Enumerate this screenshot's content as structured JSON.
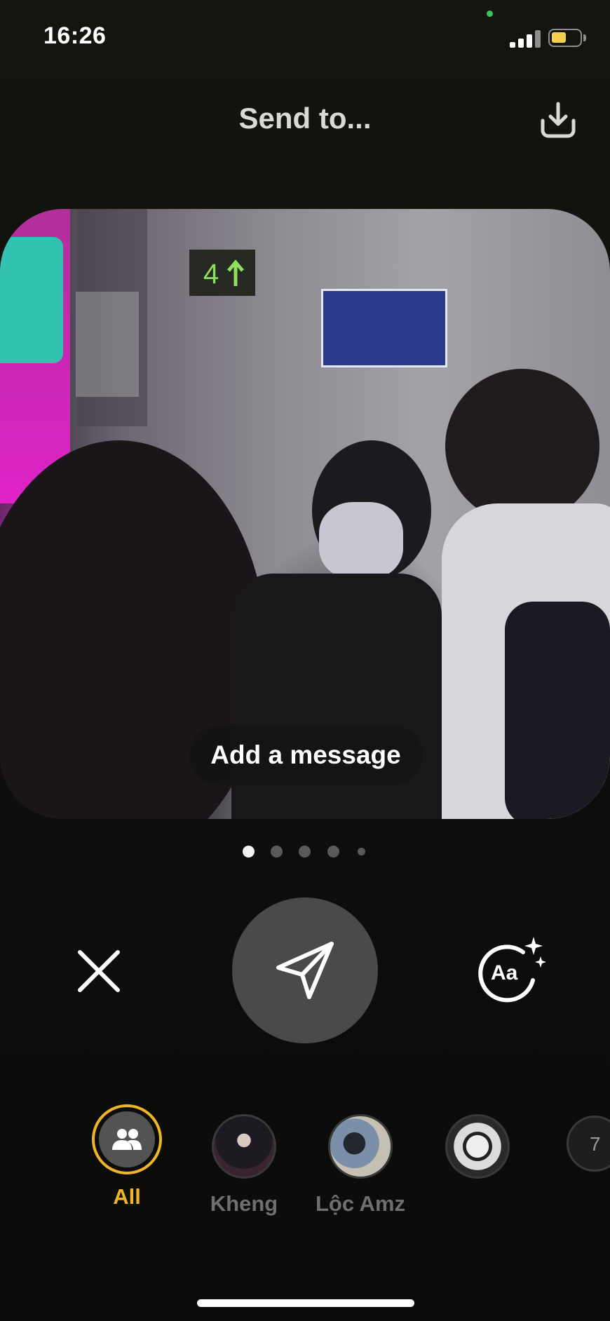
{
  "status_bar": {
    "time": "16:26",
    "signal_icon": "cellular-signal-icon",
    "battery_icon": "battery-icon",
    "battery_color": "#f4d14c",
    "mic_indicator_color": "#35c759"
  },
  "header": {
    "title": "Send to...",
    "download_icon": "download-icon"
  },
  "photo": {
    "message_placeholder": "Add a message",
    "page_count": 5,
    "current_page": 1
  },
  "controls": {
    "close_icon": "close-icon",
    "send_icon": "send-paper-plane-icon",
    "text_effects_icon": "text-effects-icon",
    "text_effects_glyph": "Aa"
  },
  "recipients": [
    {
      "label": "All",
      "selected": true,
      "icon": "friends-group-icon"
    },
    {
      "label": "Kheng",
      "selected": false
    },
    {
      "label": "Lộc Amz",
      "selected": false
    },
    {
      "label": "",
      "selected": false
    },
    {
      "label": "7",
      "selected": false
    }
  ],
  "colors": {
    "accent": "#f0b429",
    "send_button_bg": "#4a4a4a",
    "background": "#0b0b09"
  }
}
